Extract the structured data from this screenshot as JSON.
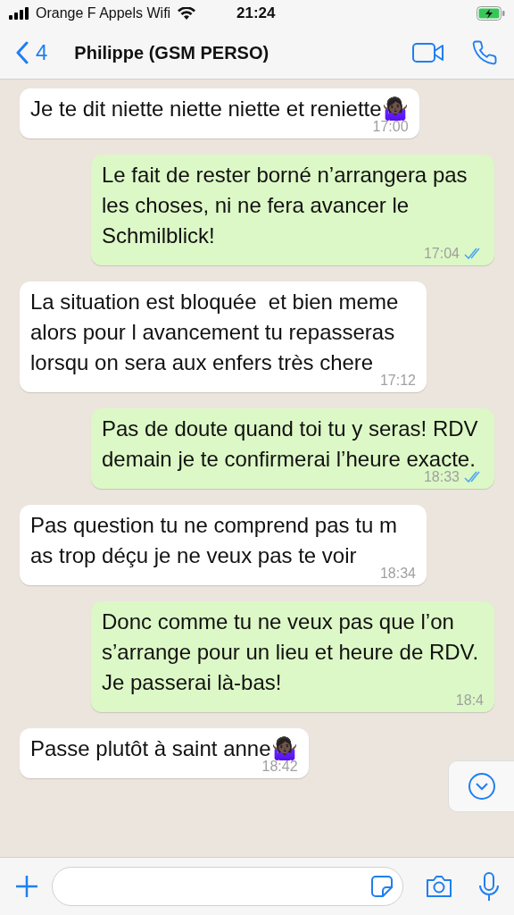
{
  "status_bar": {
    "carrier": "Orange F Appels Wifi",
    "time": "21:24"
  },
  "header": {
    "back_count": "4",
    "title": "Philippe (GSM PERSO)"
  },
  "messages": [
    {
      "kind": "received",
      "text": "Je te dit niette niette niette et reniette🤷🏿‍♀️",
      "time": "17:00"
    },
    {
      "kind": "sent",
      "text": "Le fait de rester borné n’arrangera pas les choses, ni ne fera avancer le Schmilblick!",
      "time": "17:04",
      "read": true
    },
    {
      "kind": "received",
      "text": "La situation est bloquée  et bien meme alors pour l avancement tu repasseras lorsqu on sera aux enfers très chere",
      "time": "17:12"
    },
    {
      "kind": "sent",
      "text": "Pas de doute quand toi tu y seras! RDV demain je te confirmerai l’heure exacte.",
      "time": "18:33",
      "read": true
    },
    {
      "kind": "received",
      "text": "Pas question tu ne comprend pas tu m as trop déçu je ne veux pas te voir",
      "time": "18:34"
    },
    {
      "kind": "sent",
      "text": "Donc comme tu ne veux pas que l’on s’arrange pour un lieu et heure de RDV. Je passerai là-bas!",
      "time": "18:4"
    },
    {
      "kind": "received",
      "text": "Passe plutôt à saint anne🤷🏿‍♀️",
      "time": "18:42"
    }
  ]
}
